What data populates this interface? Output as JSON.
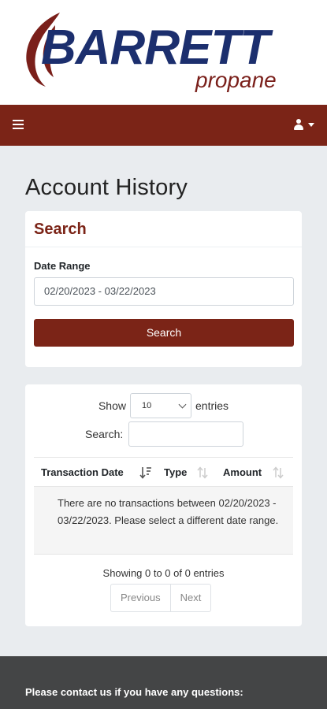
{
  "brand": {
    "name": "BARRETT",
    "tagline": "propane",
    "colors": {
      "primary": "#7b2417",
      "navy": "#1c2f6e",
      "footer": "#444546",
      "page_bg": "#e9ecef"
    }
  },
  "navbar": {
    "menu_icon": "hamburger-icon",
    "user_icon": "user-icon",
    "dropdown_icon": "caret-down-icon"
  },
  "page": {
    "title": "Account History"
  },
  "search_panel": {
    "heading": "Search",
    "date_range_label": "Date Range",
    "date_range_value": "02/20/2023 - 03/22/2023",
    "submit_label": "Search"
  },
  "table": {
    "show_label": "Show",
    "page_length": "10",
    "entries_label": "entries",
    "filter_label": "Search:",
    "filter_value": "",
    "columns": [
      "Transaction Date",
      "Type",
      "Amount"
    ],
    "sort_icons": [
      "sort-descending-icon",
      "sort-icon",
      "sort-icon"
    ],
    "empty_message": "There are no transactions between 02/20/2023 - 03/22/2023. Please select a different date range.",
    "info": "Showing 0 to 0 of 0 entries",
    "pagination": {
      "previous": "Previous",
      "next": "Next"
    }
  },
  "footer": {
    "contact_text": "Please contact us if you have any questions:"
  }
}
